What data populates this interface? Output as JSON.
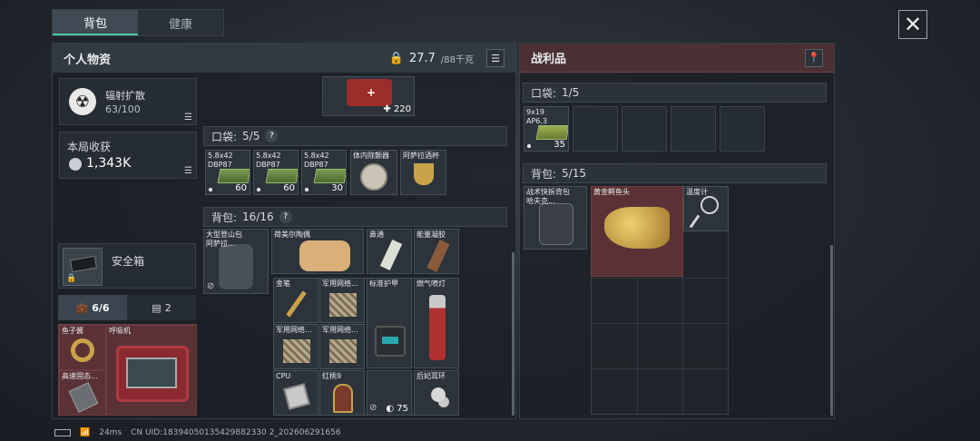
{
  "tabs": [
    {
      "label": "背包"
    },
    {
      "label": "健康"
    }
  ],
  "close_icon": "close-icon",
  "personal": {
    "title": "个人物资",
    "weight": "27.7",
    "weight_max": "/88千克"
  },
  "loot": {
    "title": "战利品"
  },
  "radiation": {
    "label": "辐射扩散",
    "value": "63/100"
  },
  "earnings": {
    "label": "本局收获",
    "value": "1,343K"
  },
  "safe": {
    "label": "安全箱"
  },
  "mini_tabs": [
    {
      "label": "6/6"
    },
    {
      "label": "2"
    }
  ],
  "pocket": {
    "label": "口袋:",
    "count": "5/5",
    "help": "?"
  },
  "backpack": {
    "label": "背包:",
    "count": "16/16",
    "help": "?"
  },
  "medkit_count": "220",
  "pocket_items": [
    {
      "label": "5.8x42\nDBP87",
      "count": "60"
    },
    {
      "label": "5.8x42\nDBP87",
      "count": "60"
    },
    {
      "label": "5.8x42\nDBP87",
      "count": "30"
    },
    {
      "label": "体内除颤器",
      "count": ""
    },
    {
      "label": "阿萨拉酒杯",
      "count": ""
    }
  ],
  "backpack_items": {
    "bag": "大型登山包\n阿萨拉...",
    "doll": "荷美尔陶偶",
    "nasal": "鼻通",
    "gel": "能量凝胶",
    "pen": "金笔",
    "net1": "军用网络...",
    "armor": "标准护甲",
    "torch": "燃气喷灯",
    "net2": "军用网络...",
    "net3": "军用网络...",
    "cpu": "CPU",
    "redpeach": "红桃9",
    "earring": "后妃耳环",
    "durability": "75"
  },
  "safebox_items": {
    "fishmeal": "鱼子酱",
    "respirator": "呼吸机",
    "drive": "高速固态..."
  },
  "loot_pocket": {
    "label": "口袋:",
    "count": "1/5",
    "item_label": "9x19\nAP6.3",
    "item_count": "35"
  },
  "loot_backpack": {
    "label": "背包:",
    "count": "5/15",
    "bag": "战术快拆背包\n哈夫克...",
    "croc": "黄金鳄鱼头",
    "thermo": "温度计"
  },
  "status": {
    "ping": "24ms",
    "uid": "CN UID:18394050135429882330 2_202606291656"
  }
}
